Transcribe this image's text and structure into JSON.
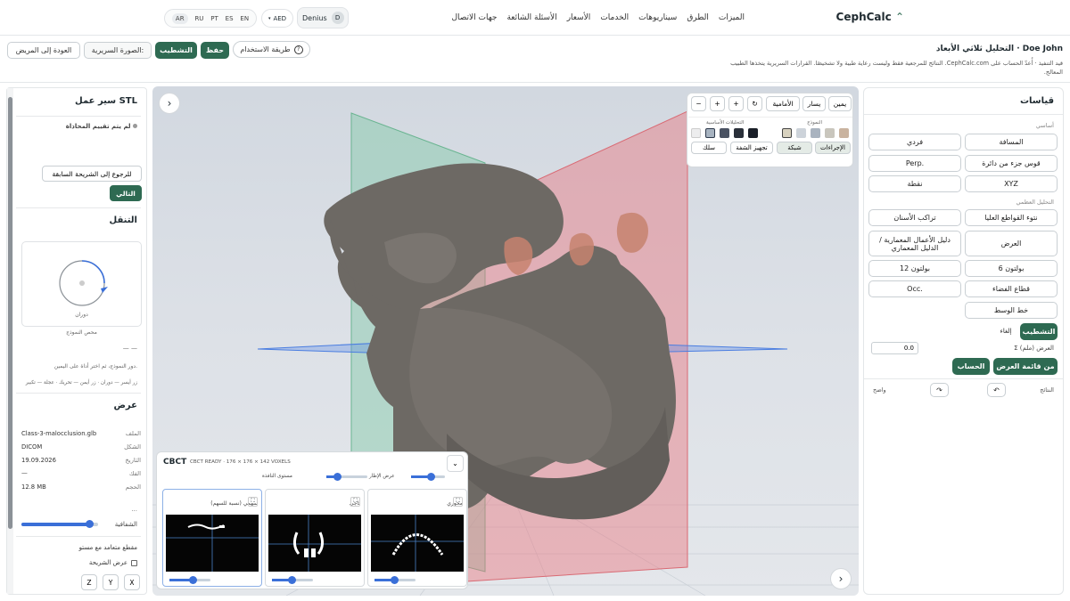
{
  "top": {
    "brand": "CephCalc",
    "nav": [
      "الميزات",
      "الطرق",
      "سيناريوهات",
      "الخدمات",
      "الأسعار",
      "الأسئلة الشائعة",
      "جهات الاتصال"
    ],
    "langs": [
      "AR",
      "RU",
      "PT",
      "ES",
      "EN"
    ],
    "currency": "AED",
    "user_name": "Denius",
    "user_initial": "D"
  },
  "sub": {
    "title": "التحليل ثلاثي الأبعاد · Doe John",
    "disclaimer": "قيد التنفيذ · أُعدّ الحساب على CephCalc.com. النتائج للمرجعية فقط وليست رعاية طبية ولا تشخيصًا. القرارات السريرية يتخذها الطبيب المعالج.",
    "usage": "طريقة الاستخدام",
    "save": "حفظ",
    "calib": "التشطيب",
    "clinical": "الصورة السريرية:",
    "back": "العودة إلى المريض"
  },
  "left": {
    "workflow_title": "سير عمل STL",
    "status": "لم يتم تقييم المحاذاة",
    "back_step": "للرجوع إلى الشريحة السابقة",
    "next": "التالي",
    "nav_title": "التنقل",
    "rot_label": "دوران",
    "center_label": "محص النموذج",
    "dash": "— —",
    "hint1": "دور النموذج، ثم اختر أداة على اليمين.",
    "hint2": "زر أيسر — دوران · زر أيمن — تحريك · عجلة — تكبير",
    "view_title": "عرض",
    "file_k": "الملف",
    "file_v": "Class-3-malocclusion.glb",
    "shape_k": "الشكل",
    "shape_v": "DICOM",
    "date_k": "التاريخ",
    "date_v": "19.09.2026",
    "jaw_k": "الفك",
    "jaw_v": "—",
    "size_k": "الحجم",
    "size_v": "12.8 MB",
    "dots": "...",
    "opacity_label": "الشفافية",
    "opacity_value": 0.9,
    "section_label": "مقطع متعامد مع مستو",
    "slice_view": "عرض الشريحة",
    "axes": [
      "X",
      "Y",
      "Z"
    ]
  },
  "right": {
    "title": "قياسات",
    "basic_label": "أساسي",
    "basic": [
      "المسافة",
      "فردي",
      "قوس جزء من دائرة",
      "Perp.",
      "XYZ",
      "نقطة"
    ],
    "dental_label": "التحليل العظمي",
    "dental": [
      "نتوء القواطع العليا",
      "تراكب الأسنان",
      "العرض",
      "دليل الأعمال المعمارية / الدليل المعماري",
      "بولتون 6",
      "بولتون 12",
      "قطاع الفضاء",
      "Occ.",
      "خط الوسط"
    ],
    "calib": "التشطيب",
    "cancel": "إلغاء",
    "sum_label": "Σ العرض (ملم)",
    "sum_value": "0.0",
    "from_list": "من قائمة العرض",
    "calc": "الحساب",
    "results_label": "النتائج",
    "clear": "واضح",
    "undo": "↶",
    "redo": "↷"
  },
  "viewport": {
    "views": [
      "يمين",
      "يسار",
      "الأمامية"
    ],
    "model_label": "النموذج",
    "basic_analysis_label": "التحليلات الأساسية",
    "procedures": "الإجراءات",
    "grid": "شبكة",
    "lip_prep": "تجهيز الشفة",
    "wire": "سلك",
    "colors": {
      "teal": "#2e6a52",
      "plane_red": "#e8757f",
      "plane_green": "#7ec8a6",
      "plane_blue": "#5b8de8",
      "bone": "#6d6964"
    }
  },
  "cbct": {
    "title": "CBCT",
    "status": "CBCT READY · 176 × 176 × 142 VOXELS",
    "window_level": "مستوى النافذة",
    "window_width": "عرض الإطار",
    "slices": [
      "سهمي (نسبة للسهم)",
      "تاجي",
      "محوري"
    ]
  }
}
